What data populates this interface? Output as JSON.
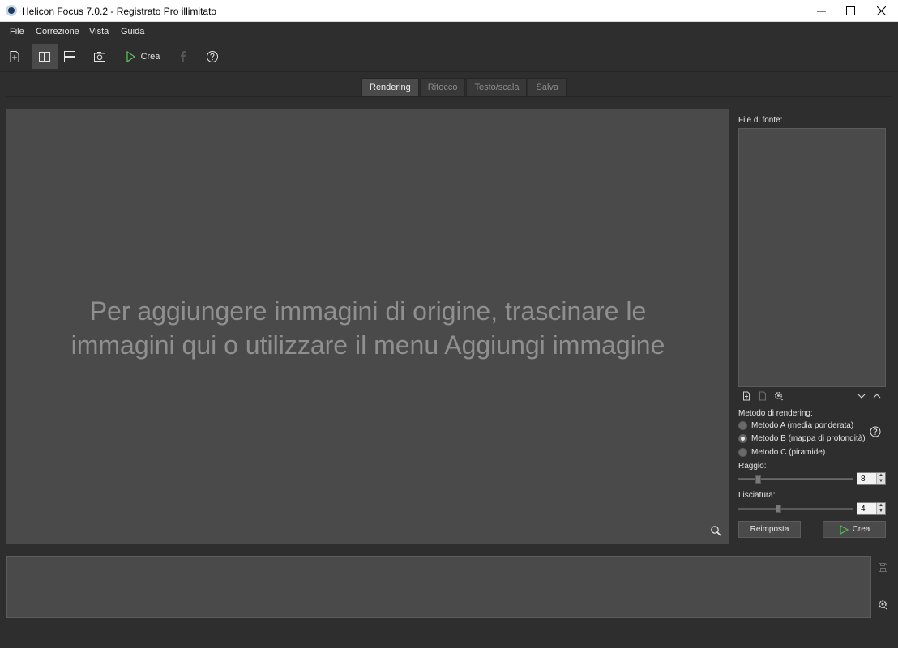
{
  "window": {
    "title": "Helicon Focus 7.0.2 - Registrato Pro illimitato"
  },
  "menu": {
    "items": [
      "File",
      "Correzione",
      "Vista",
      "Guida"
    ]
  },
  "toolbar": {
    "create_label": "Crea",
    "icons": [
      "add-image-icon",
      "split-vertical-icon",
      "split-horizontal-icon",
      "camera-icon",
      "play-icon",
      "facebook-icon",
      "help-icon"
    ]
  },
  "tabs": [
    "Rendering",
    "Ritocco",
    "Testo/scala",
    "Salva"
  ],
  "active_tab": "Rendering",
  "canvas": {
    "hint_line1": "Per aggiungere immagini di origine, trascinare le",
    "hint_line2": "immagini qui o utilizzare il menu Aggiungi immagine"
  },
  "panel": {
    "source_files_label": "File di fonte:",
    "rendering_method_label": "Metodo di rendering:",
    "methods": [
      {
        "label": "Metodo A (media ponderata)",
        "checked": false
      },
      {
        "label": "Metodo B (mappa di profondità)",
        "checked": true
      },
      {
        "label": "Metodo C (piramide)",
        "checked": false
      }
    ],
    "radius_label": "Raggio:",
    "radius_value": "8",
    "smoothing_label": "Lisciatura:",
    "smoothing_value": "4",
    "reset_label": "Reimposta",
    "create_label": "Crea"
  },
  "colors": {
    "background": "#2e2e2e",
    "panel": "#4a4a4a",
    "accent_green": "#5cb85c",
    "text": "#e6e6e6",
    "hint_text": "#8f8f8f"
  }
}
